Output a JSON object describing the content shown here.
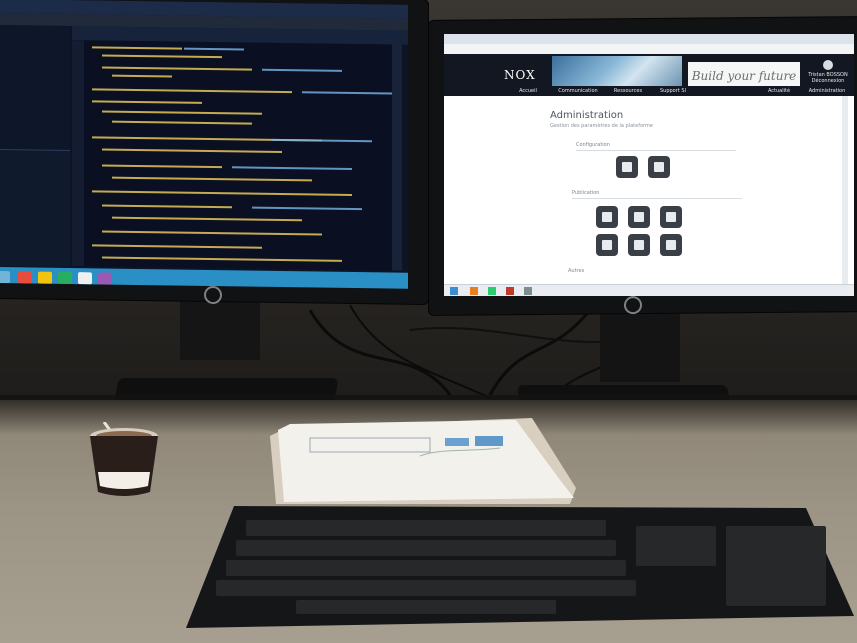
{
  "scene": {
    "description_tag": "Dual-monitor desk setup",
    "colors": {
      "ide_background": "#0c1426",
      "taskbar_blue": "#2a8fc4",
      "site_header": "#121722",
      "desk": "#9c9485"
    }
  },
  "right_screen": {
    "site": {
      "logo": "NOX",
      "slogan": "Build your future",
      "user_name": "Tristan BOSSON",
      "user_action": "Déconnexion",
      "nav": [
        "Accueil",
        "Communication",
        "Ressources",
        "Support SI",
        "",
        "Actualité",
        "Administration"
      ]
    },
    "page": {
      "title": "Administration",
      "subtitle": "Gestion des paramètres de la plateforme",
      "section_1": "Configuration",
      "section_2": "Publication",
      "section_3": "Autres"
    }
  },
  "icons": {
    "left_screen": "code-editor",
    "right_screen_tiles": [
      "phone-icon",
      "users-icon",
      "edit-icon",
      "calendar-icon",
      "document-icon",
      "info-icon",
      "news-icon",
      "list-icon"
    ]
  }
}
